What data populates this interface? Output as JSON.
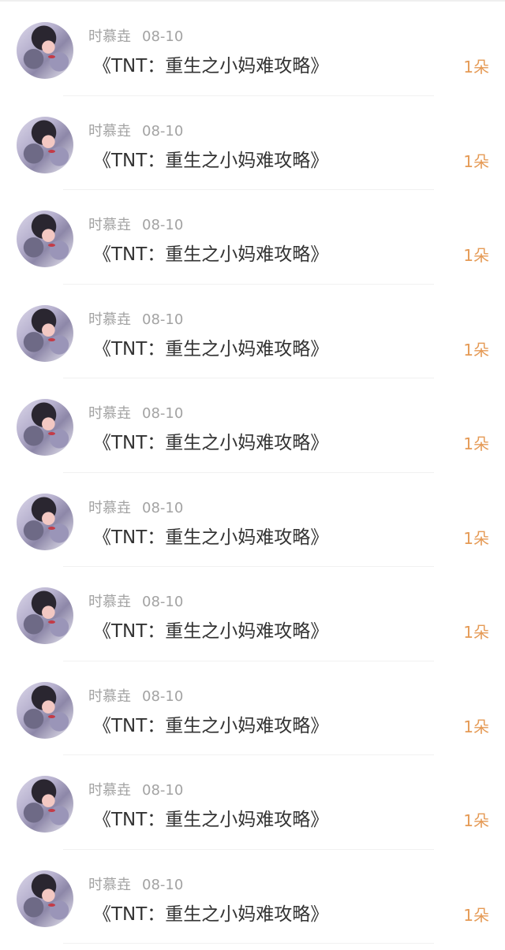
{
  "items": [
    {
      "username": "时慕垚",
      "date": "08-10",
      "title": "《TNT：重生之小妈难攻略》",
      "count": "1朵"
    },
    {
      "username": "时慕垚",
      "date": "08-10",
      "title": "《TNT：重生之小妈难攻略》",
      "count": "1朵"
    },
    {
      "username": "时慕垚",
      "date": "08-10",
      "title": "《TNT：重生之小妈难攻略》",
      "count": "1朵"
    },
    {
      "username": "时慕垚",
      "date": "08-10",
      "title": "《TNT：重生之小妈难攻略》",
      "count": "1朵"
    },
    {
      "username": "时慕垚",
      "date": "08-10",
      "title": "《TNT：重生之小妈难攻略》",
      "count": "1朵"
    },
    {
      "username": "时慕垚",
      "date": "08-10",
      "title": "《TNT：重生之小妈难攻略》",
      "count": "1朵"
    },
    {
      "username": "时慕垚",
      "date": "08-10",
      "title": "《TNT：重生之小妈难攻略》",
      "count": "1朵"
    },
    {
      "username": "时慕垚",
      "date": "08-10",
      "title": "《TNT：重生之小妈难攻略》",
      "count": "1朵"
    },
    {
      "username": "时慕垚",
      "date": "08-10",
      "title": "《TNT：重生之小妈难攻略》",
      "count": "1朵"
    },
    {
      "username": "时慕垚",
      "date": "08-10",
      "title": "《TNT：重生之小妈难攻略》",
      "count": "1朵"
    }
  ],
  "colors": {
    "username": "#a3a3a3",
    "title": "#333333",
    "count": "#e59a55"
  }
}
